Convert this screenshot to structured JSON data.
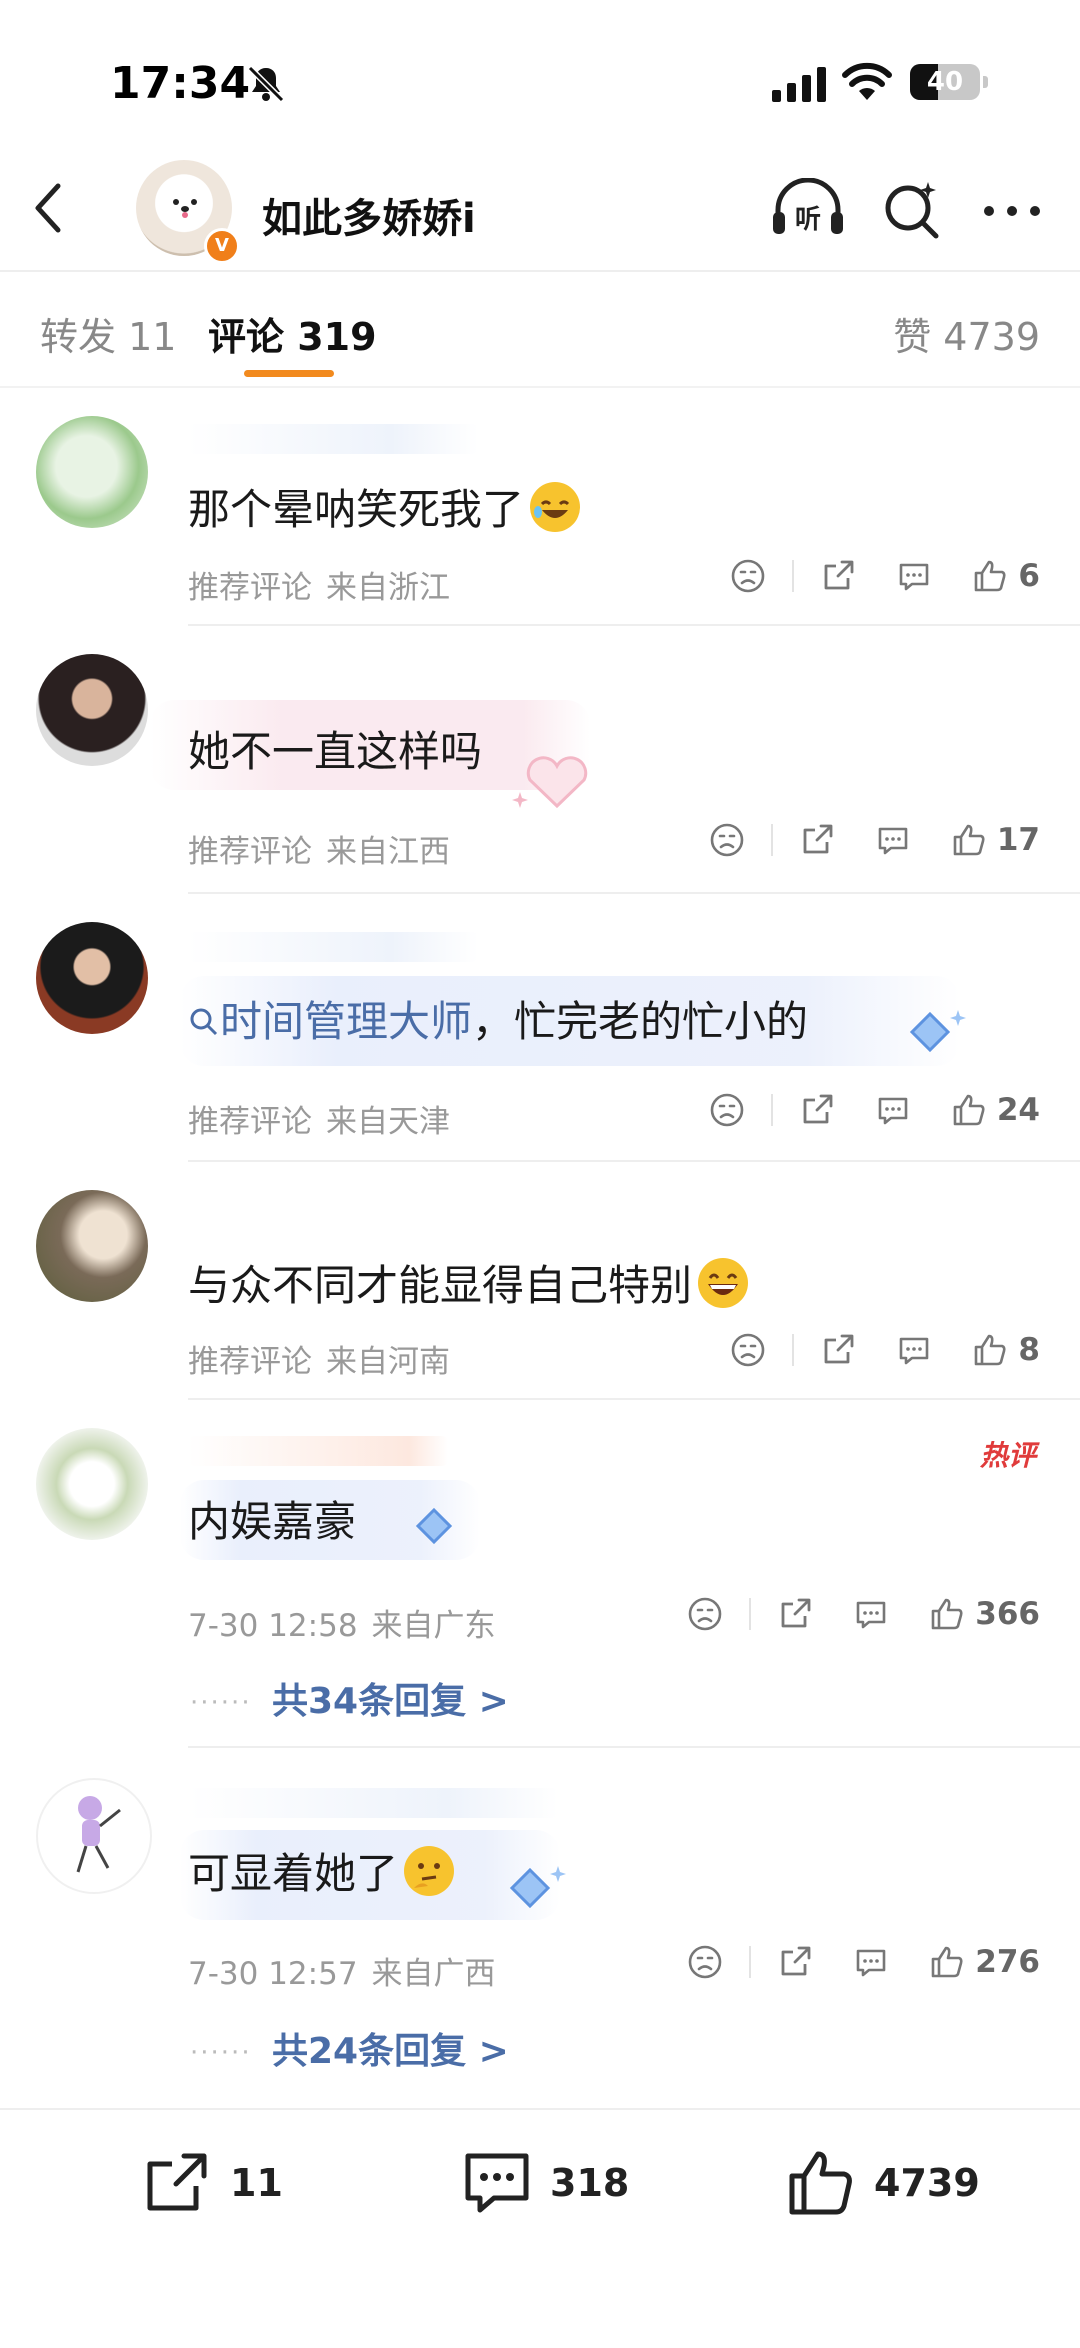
{
  "status": {
    "time": "17:34",
    "battery": "40"
  },
  "header": {
    "title": "如此多娇娇i",
    "verified": "V"
  },
  "tabs": {
    "repost": "转发 11",
    "comments": "评论 319",
    "likes": "赞 4739"
  },
  "comments": [
    {
      "text": "那个晕呐笑死我了",
      "emoji": "rofl",
      "tag": "推荐评论",
      "location": "来自浙江",
      "likes": "6"
    },
    {
      "text": "她不一直这样吗",
      "tag": "推荐评论",
      "location": "来自江西",
      "likes": "17"
    },
    {
      "link_prefix": "Q",
      "text_link": "时间管理大师",
      "text": "，忙完老的忙小的",
      "tag": "推荐评论",
      "location": "来自天津",
      "likes": "24"
    },
    {
      "text": "与众不同才能显得自己特别",
      "emoji": "grin",
      "tag": "推荐评论",
      "location": "来自河南",
      "likes": "8"
    },
    {
      "text": "内娱嘉豪",
      "hot": "热评",
      "time": "7-30 12:58",
      "location": "来自广东",
      "likes": "366",
      "replies": "共34条回复 >"
    },
    {
      "text": "可显着她了",
      "emoji": "thinking",
      "time": "7-30 12:57",
      "location": "来自广西",
      "likes": "276",
      "replies": "共24条回复 >"
    }
  ],
  "bottom": {
    "repost": "11",
    "comments": "318",
    "likes": "4739"
  },
  "colors": {
    "accent": "#f28a1e",
    "link": "#4a6da7",
    "hot": "#e03b3b"
  }
}
